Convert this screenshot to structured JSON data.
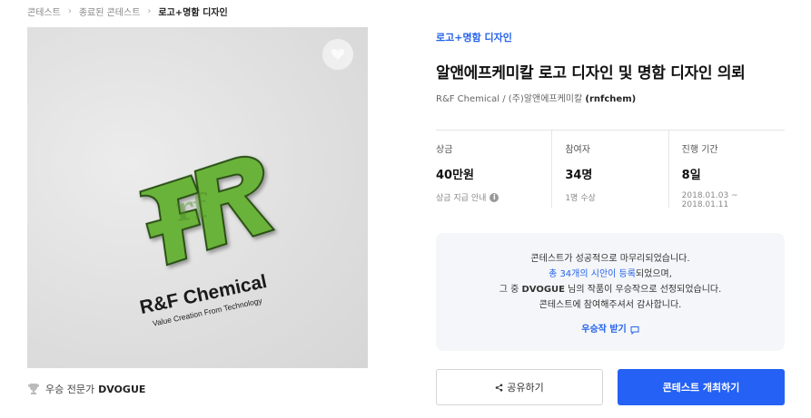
{
  "breadcrumb": {
    "items": [
      "콘테스트",
      "종료된 콘테스트",
      "로고+명함 디자인"
    ]
  },
  "thumbnail": {
    "logo_monogram": "rf",
    "logo_name": "R&F Chemical",
    "logo_tagline": "Value Creation From Technology",
    "logo_color": "#6ab33a"
  },
  "winner": {
    "label": "우승 전문가",
    "name": "DVOGUE"
  },
  "contest": {
    "category": "로고+명함 디자인",
    "title": "알앤에프케미칼 로고 디자인 및 명함 디자인 의뢰",
    "client_name": "R&F Chemical / (주)알앤에프케미칼",
    "client_handle": "(rnfchem)"
  },
  "stats": [
    {
      "label": "상금",
      "value": "40만원",
      "sub": "상금 지급 안내"
    },
    {
      "label": "참여자",
      "value": "34명",
      "sub": "1명 수상"
    },
    {
      "label": "진행 기간",
      "value": "8일",
      "sub": "2018.01.03 ~ 2018.01.11"
    }
  ],
  "notice": {
    "line1": "콘테스트가 성공적으로 마무리되었습니다.",
    "line2_link": "총 34개의 시안이 등록",
    "line2_rest": "되었으며,",
    "line3_prefix": "그 중 ",
    "line3_name": "DVOGUE",
    "line3_rest": " 님의 작품이 우승작으로 선정되었습니다.",
    "line4": "콘테스트에 참여해주셔서 감사합니다.",
    "cta": "우승작 받기"
  },
  "buttons": {
    "share": "공유하기",
    "host": "콘테스트 개최하기"
  },
  "colors": {
    "accent": "#2461f4",
    "link": "#2563eb"
  }
}
